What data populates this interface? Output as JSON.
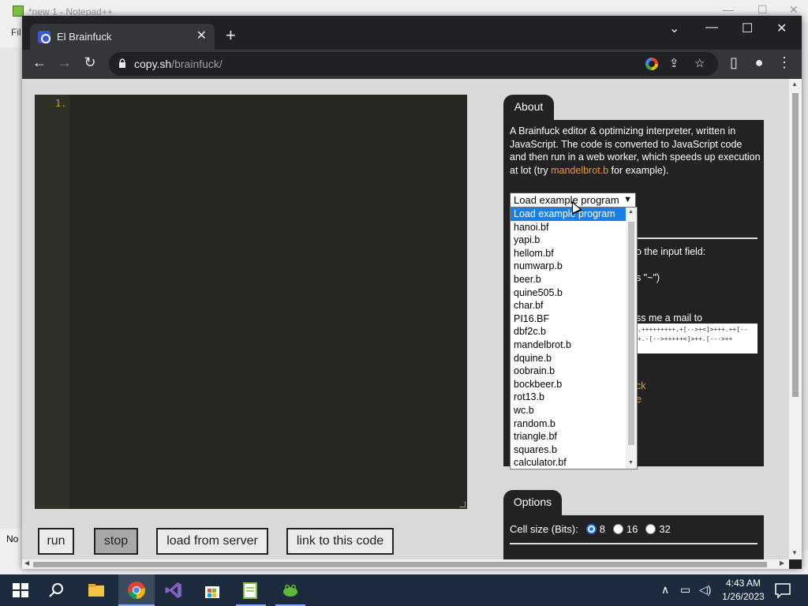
{
  "background_window": {
    "title": "*new 1 - Notepad++",
    "menu_fragment": "Fil",
    "status_fragment": "No"
  },
  "browser": {
    "tab_title": "El Brainfuck",
    "url_host": "copy.sh",
    "url_path": "/brainfuck/"
  },
  "editor": {
    "line_number": "1."
  },
  "buttons": {
    "run": "run",
    "stop": "stop",
    "load": "load from server",
    "link": "link to this code"
  },
  "about": {
    "tab": "About",
    "text_before": "A Brainfuck editor & optimizing interpreter, written in JavaScript. The code is converted to JavaScript code and then run in a web worker, which speeds up execution at lot (try ",
    "link": "mandelbrot.b",
    "text_after": " for example).",
    "select_value": "Load example program",
    "partial_1": "o the input field:",
    "partial_2": "s \"~\")",
    "partial_3": "ss me a mail to",
    "code_line_1": ".+++++++++.+[-->+<]>+++.++[--",
    "code_line_2": "+.-[-->+++++<]>++.[--->++",
    "partial_orange_1": "ck",
    "partial_orange_2": "e"
  },
  "dropdown": {
    "items": [
      "Load example program",
      "hanoi.bf",
      "yapi.b",
      "hellom.bf",
      "numwarp.b",
      "beer.b",
      "quine505.b",
      "char.bf",
      "PI16.BF",
      "dbf2c.b",
      "mandelbrot.b",
      "dquine.b",
      "oobrain.b",
      "bockbeer.b",
      "rot13.b",
      "wc.b",
      "random.b",
      "triangle.bf",
      "squares.b",
      "calculator.bf"
    ]
  },
  "options": {
    "tab": "Options",
    "cell_size_label": "Cell size (Bits):",
    "cell_sizes": [
      "8",
      "16",
      "32"
    ],
    "selected_cell_size": "8"
  },
  "taskbar": {
    "time": "4:43 AM",
    "date": "1/26/2023"
  },
  "colors": {
    "accent": "#1e7ee8",
    "link_orange": "#e89a2f",
    "panel_dark": "#222222",
    "editor_bg": "#272822"
  }
}
